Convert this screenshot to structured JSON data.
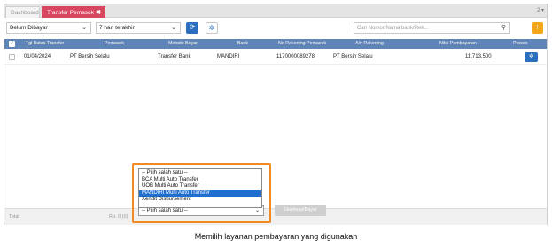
{
  "tabs": {
    "dashboard": "Dashboard",
    "active": "Transfer Pemasok",
    "close_symbol": "✖",
    "counter": "2 ▾"
  },
  "filters": {
    "status_value": "Belum Dibayar",
    "period_value": "7 hari terakhir",
    "search_placeholder": "Cari Nomor/Nama bank/Rek...",
    "refresh_symbol": "⟳",
    "settings_symbol": "✲",
    "info_symbol": "!"
  },
  "table": {
    "headers": [
      "Tgl Batas Transfer",
      "Pemasok",
      "Metode Bayar",
      "Bank",
      "No Rekening Pemasok",
      "A/n Rekening",
      "Nilai Pembayaran",
      "Proses"
    ],
    "rows": [
      {
        "date": "01/04/2024",
        "supplier": "PT Bersih Selalu",
        "method": "Transfer Bank",
        "bank": "MANDIRI",
        "account_no": "1170000089278",
        "account_name": "PT Bersih Selalu",
        "amount": "11,713,500",
        "process_symbol": "✲"
      }
    ]
  },
  "footer": {
    "total_label": "Total",
    "total_value": "Rp. 0 (0)",
    "payment_select_value": "-- Pilih salah satu --",
    "execute_label": "Eksekusi/Bayar"
  },
  "dropdown": {
    "options": [
      "-- Pilih salah satu --",
      "BCA Multi Auto Transfer",
      "UOB Multi Auto Transfer",
      "MANDIRI Multi Auto Transfer",
      "Xendit Disbursement"
    ],
    "selected_index": 3
  },
  "caption": "Memilih layanan pembayaran yang digunakan",
  "colors": {
    "active_tab": "#d9465f",
    "header_bg": "#5f84b6",
    "primary_button": "#2d6fbf",
    "warning_button": "#f2a71b",
    "highlight": "#f08a24",
    "selected_option": "#1f6fd0"
  }
}
